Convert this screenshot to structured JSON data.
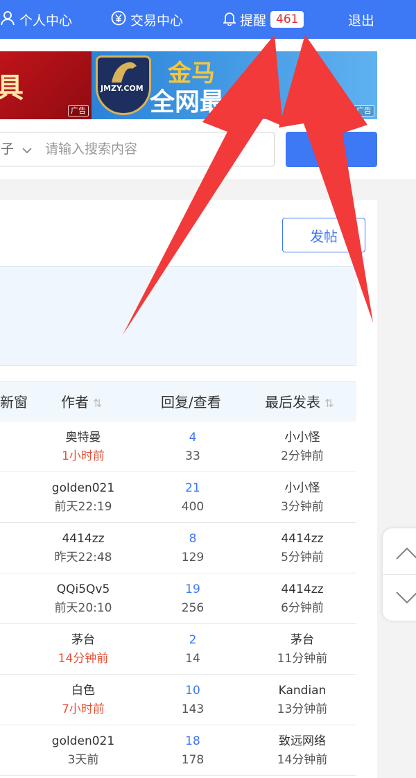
{
  "topbar": {
    "personal_center": "个人中心",
    "trade_center": "交易中心",
    "alert_label": "提醒",
    "alert_count": "461",
    "logout": "退出"
  },
  "ads": {
    "ad1_text": "具",
    "ad1_tag": "广告",
    "ad2_logo": "JMZY.COM",
    "ad2_line1": "金马",
    "ad2_line2": "全网最",
    "ad2_tag": "广告"
  },
  "search": {
    "scope": "子",
    "placeholder": "请输入搜索内容"
  },
  "card": {
    "post_button": "发帖"
  },
  "table": {
    "headers": {
      "new_window": "新窗",
      "author": "作者",
      "reply_view": "回复/查看",
      "last_post": "最后发表"
    },
    "rows": [
      {
        "author": "奥特曼",
        "author_time": "1小时前",
        "author_time_red": true,
        "replies": "4",
        "views": "33",
        "last_user": "小小怪",
        "last_time": "2分钟前"
      },
      {
        "author": "golden021",
        "author_time": "前天22:19",
        "author_time_red": false,
        "replies": "21",
        "views": "400",
        "last_user": "小小怪",
        "last_time": "3分钟前"
      },
      {
        "author": "4414zz",
        "author_time": "昨天22:48",
        "author_time_red": false,
        "replies": "8",
        "views": "129",
        "last_user": "4414zz",
        "last_time": "5分钟前"
      },
      {
        "author": "QQi5Qv5",
        "author_time": "前天20:10",
        "author_time_red": false,
        "replies": "19",
        "views": "256",
        "last_user": "4414zz",
        "last_time": "6分钟前"
      },
      {
        "author": "茅台",
        "author_time": "14分钟前",
        "author_time_red": true,
        "replies": "2",
        "views": "14",
        "last_user": "茅台",
        "last_time": "11分钟前"
      },
      {
        "author": "白色",
        "author_time": "7小时前",
        "author_time_red": true,
        "replies": "10",
        "views": "143",
        "last_user": "Kandian",
        "last_time": "13分钟前"
      },
      {
        "author": "golden021",
        "author_time": "3天前",
        "author_time_red": false,
        "replies": "18",
        "views": "178",
        "last_user": "致远网络",
        "last_time": "14分钟前"
      }
    ]
  },
  "colors": {
    "brand_blue": "#3d78f5",
    "badge_red": "#e02b2b",
    "arrow_red": "#f23a3a"
  }
}
